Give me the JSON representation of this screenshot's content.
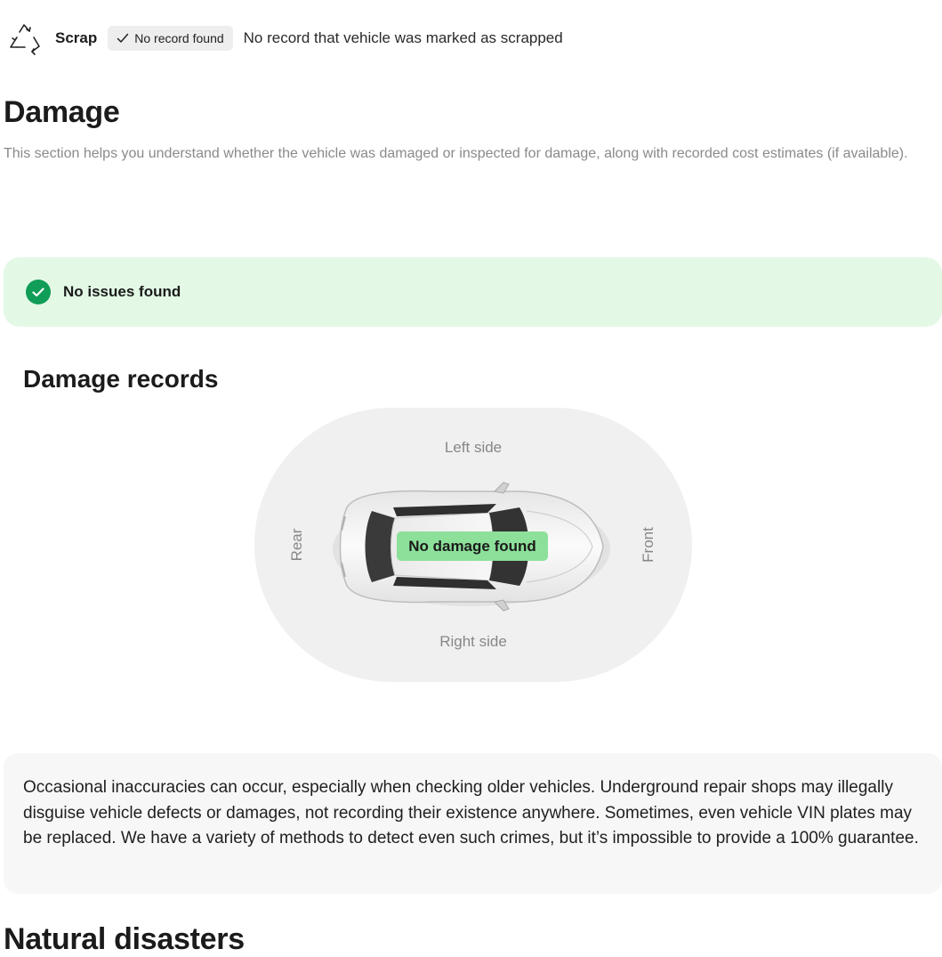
{
  "scrap": {
    "icon": "recycle-icon",
    "label": "Scrap",
    "badge": {
      "icon": "check-icon",
      "label": "No record found"
    },
    "description": "No record that vehicle was marked as scrapped"
  },
  "damage": {
    "title": "Damage",
    "description": "This section helps you understand whether the vehicle was damaged or inspected for damage, along with recorded cost estimates (if available).",
    "status": {
      "icon": "check-circle-icon",
      "label": "No issues found",
      "color": "#0f9d58",
      "background": "#e3f9e6"
    },
    "records": {
      "title": "Damage records",
      "diagram": {
        "left_label": "Left side",
        "right_label": "Right side",
        "rear_label": "Rear",
        "front_label": "Front",
        "car_image": "car-top-view",
        "badge_label": "No damage found",
        "badge_color": "#8ce09a"
      }
    },
    "disclaimer": "Occasional inaccuracies can occur, especially when checking older vehicles. Underground repair shops may illegally disguise vehicle defects or damages, not recording their existence anywhere. Sometimes, even vehicle VIN plates may be replaced. We have a variety of methods to detect even such crimes, but it’s impossible to provide a 100% guarantee."
  },
  "natural_disasters": {
    "title": "Natural disasters"
  }
}
